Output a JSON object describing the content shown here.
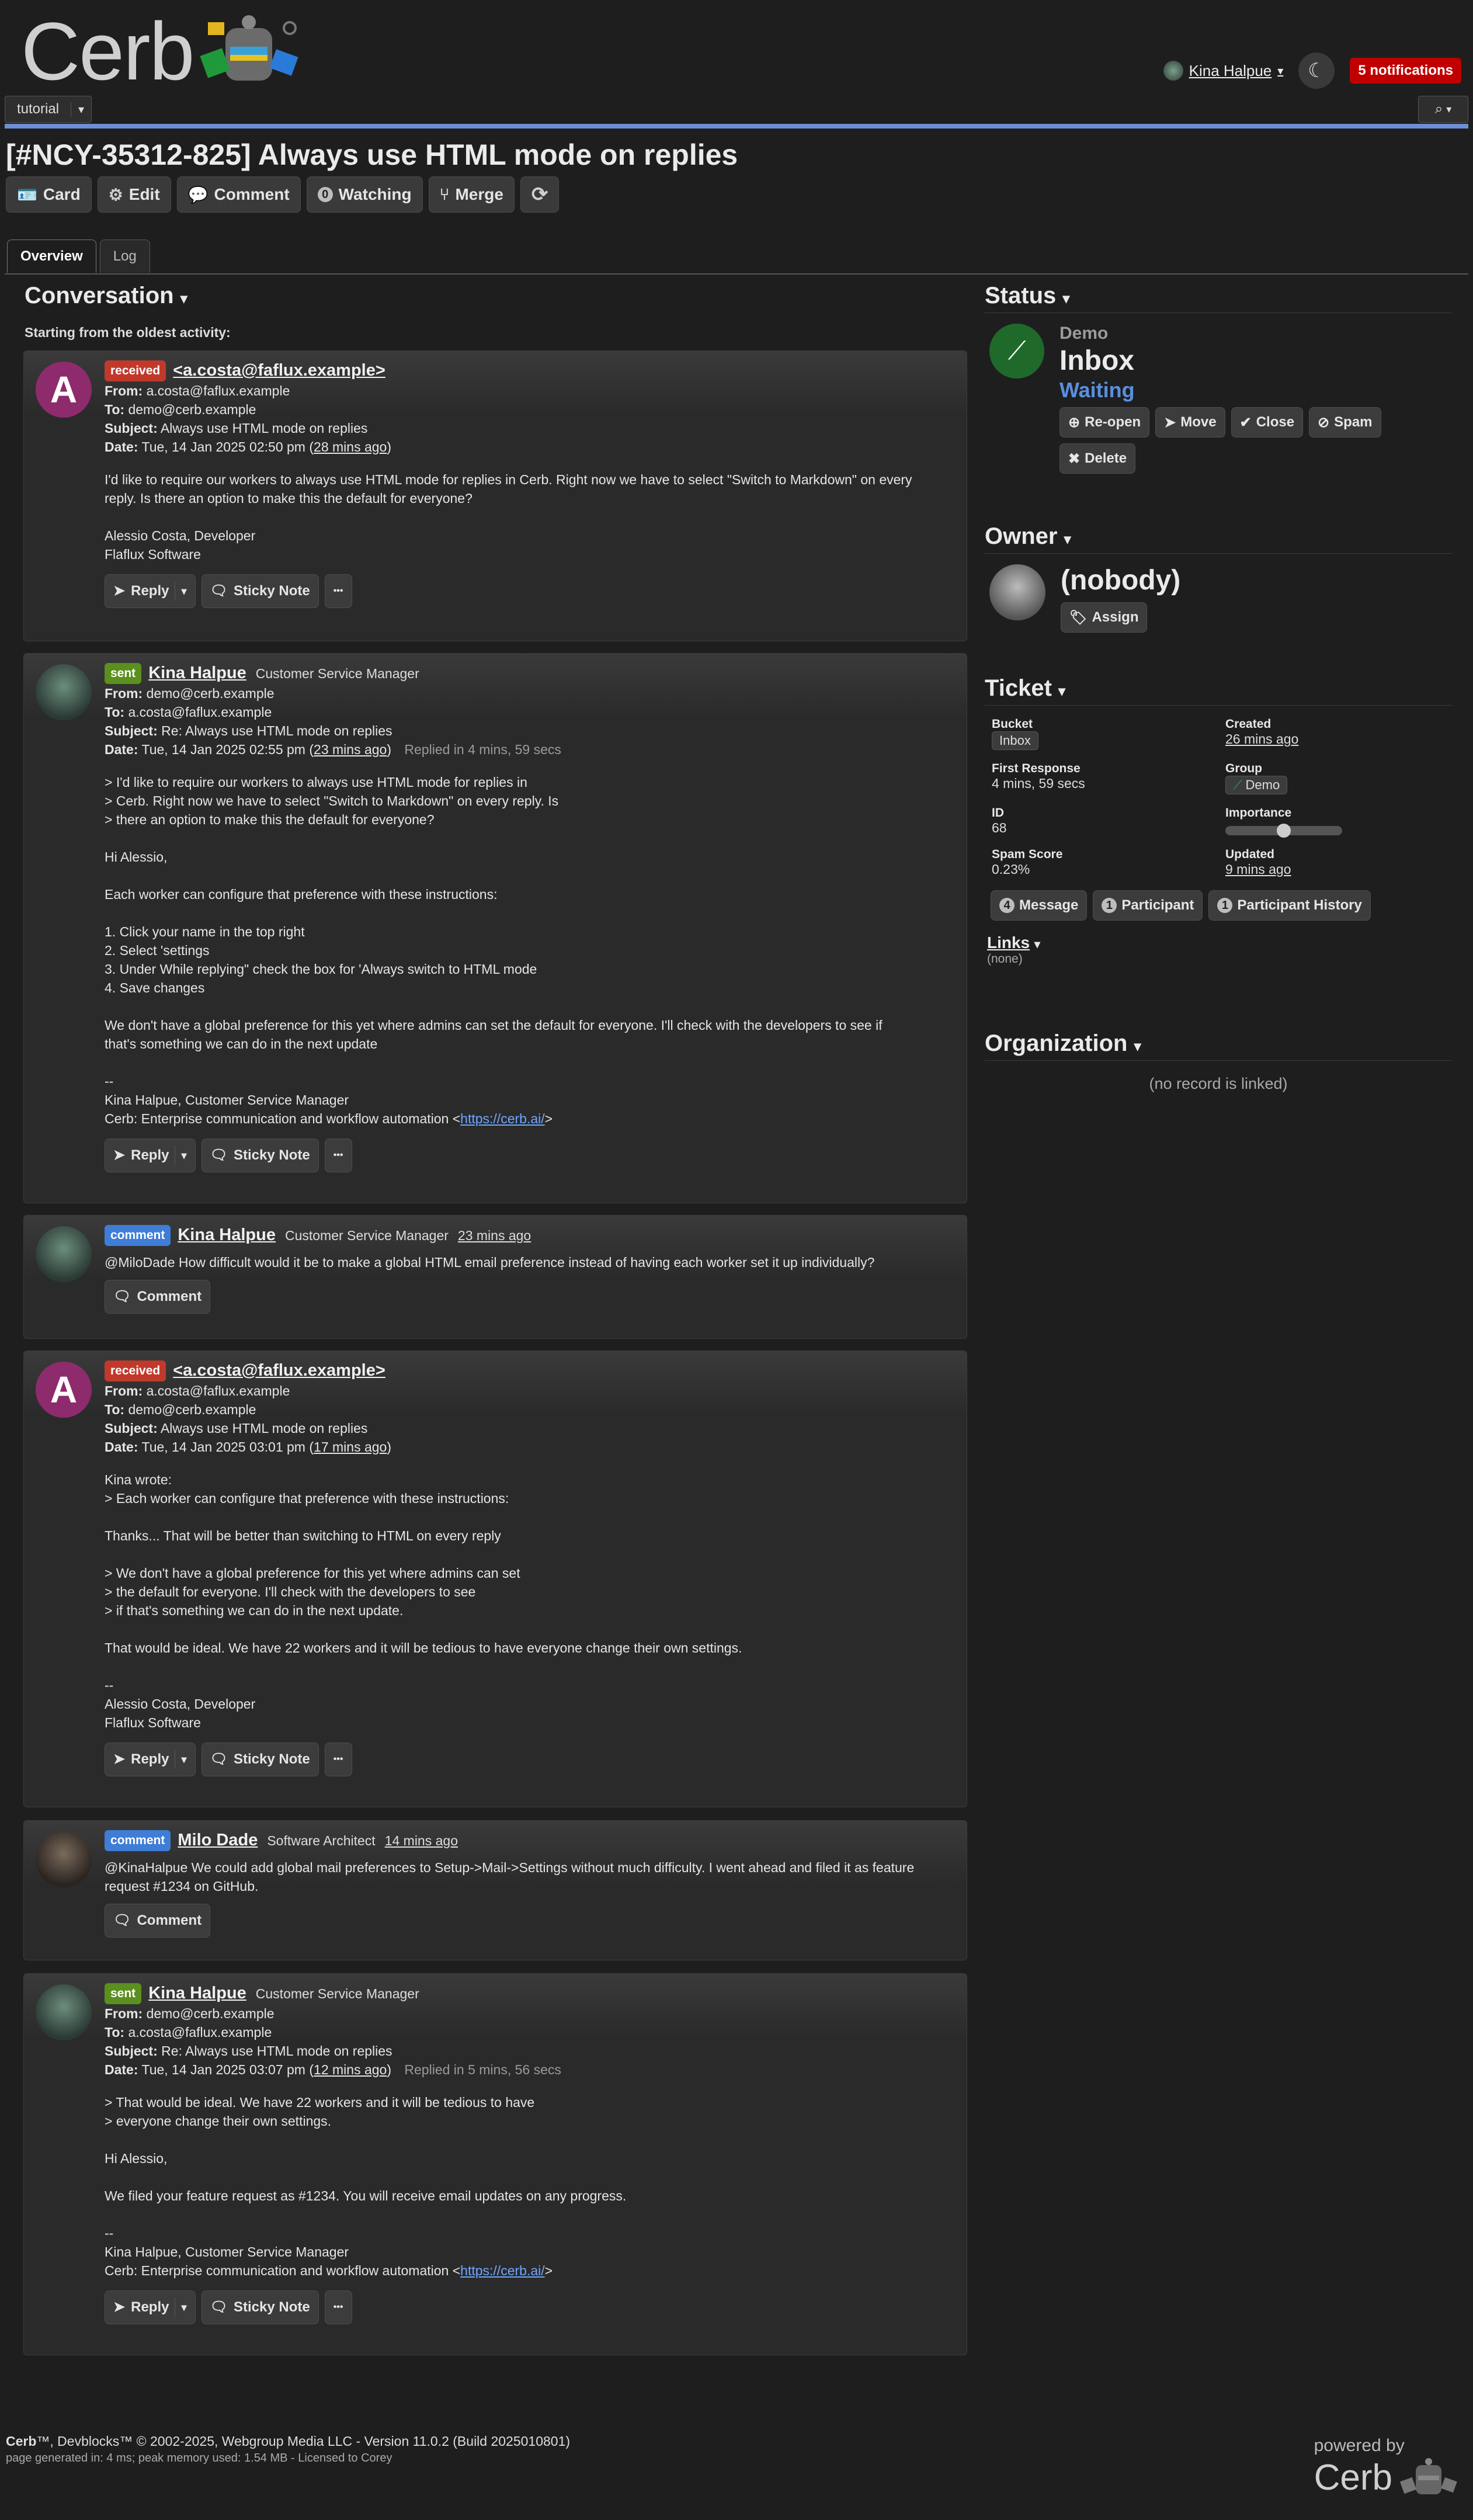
{
  "app": {
    "logo": "Cerb",
    "powered_by": "powered by",
    "powered_logo": "Cerb"
  },
  "header": {
    "user": "Kina Halpue",
    "notifications": "5 notifications"
  },
  "topbar": {
    "workspace": "tutorial"
  },
  "ticket": {
    "title": "[#NCY-35312-825] Always use HTML mode on replies",
    "toolbar": {
      "card": "Card",
      "edit": "Edit",
      "comment": "Comment",
      "watching_count": "0",
      "watching": "Watching",
      "merge": "Merge"
    },
    "tabs": [
      "Overview",
      "Log"
    ]
  },
  "conversation": {
    "heading": "Conversation",
    "sort_note": "Starting from the oldest activity:",
    "messages": [
      {
        "badge": "received",
        "sender": "<a.costa@faflux.example>",
        "avatar_letter": "A",
        "from": "a.costa@faflux.example",
        "to": "demo@cerb.example",
        "subject": "Always use HTML mode on replies",
        "date": "Tue, 14 Jan 2025 02:50 pm",
        "ago": "28 mins ago",
        "body": [
          "I'd like to require our workers to always use HTML mode for replies in Cerb. Right now we have to select \"Switch to Markdown\" on every",
          "reply. Is there an option to make this the default for everyone?",
          "",
          "Alessio Costa, Developer",
          "Flaflux Software"
        ]
      },
      {
        "badge": "sent",
        "sender": "Kina Halpue",
        "role": "Customer Service Manager",
        "from": "demo@cerb.example",
        "to": "a.costa@faflux.example",
        "subject": "Re: Always use HTML mode on replies",
        "date": "Tue, 14 Jan 2025 02:55 pm",
        "ago": "23 mins ago",
        "replied": "Replied in 4 mins, 59 secs",
        "body": [
          "> I'd like to require our workers to always use HTML mode for replies in",
          "> Cerb. Right now we have to select \"Switch to Markdown\" on every reply. Is",
          "> there an option to make this the default for everyone?",
          "",
          "Hi Alessio,",
          "",
          "Each worker can configure that preference with these instructions:",
          "",
          "1. Click your name in the top right",
          "2. Select 'settings",
          "3. Under While replying\" check the box for 'Always switch to HTML mode",
          "4. Save changes",
          "",
          "We don't have a global preference for this yet where admins can set the default for everyone. I'll check with the developers to see if",
          "that's something we can do in the next update",
          "",
          "--",
          "Kina Halpue, Customer Service Manager"
        ],
        "sig_prefix": "Cerb: Enterprise communication and workflow automation <",
        "sig_link": "https://cerb.ai/",
        "sig_suffix": ">"
      },
      {
        "badge": "comment",
        "sender": "Kina Halpue",
        "role": "Customer Service Manager",
        "ago": "23 mins ago",
        "body": "@MiloDade How difficult would it be to make a global HTML email preference instead of having each worker set it up individually?"
      },
      {
        "badge": "received",
        "sender": "<a.costa@faflux.example>",
        "avatar_letter": "A",
        "from": "a.costa@faflux.example",
        "to": "demo@cerb.example",
        "subject": "Always use HTML mode on replies",
        "date": "Tue, 14 Jan 2025 03:01 pm",
        "ago": "17 mins ago",
        "body": [
          "Kina wrote:",
          "> Each worker can configure that preference with these instructions:",
          "",
          "Thanks... That will be better than switching to HTML on every reply",
          "",
          "> We don't have a global preference for this yet where admins can set",
          "> the default for everyone. I'll check with the developers to see",
          "> if that's something we can do in the next update.",
          "",
          "That would be ideal. We have 22 workers and it will be tedious to have everyone change their own settings.",
          "",
          "--",
          "Alessio Costa, Developer",
          "Flaflux Software"
        ]
      },
      {
        "badge": "comment",
        "sender": "Milo Dade",
        "role": "Software Architect",
        "ago": "14 mins ago",
        "body": "@KinaHalpue We could add global mail preferences to Setup->Mail->Settings without much difficulty. I went ahead and filed it as feature",
        "body2": "request #1234 on GitHub."
      },
      {
        "badge": "sent",
        "sender": "Kina Halpue",
        "role": "Customer Service Manager",
        "from": "demo@cerb.example",
        "to": "a.costa@faflux.example",
        "subject": "Re: Always use HTML mode on replies",
        "date": "Tue, 14 Jan 2025 03:07 pm",
        "ago": "12 mins ago",
        "replied": "Replied in 5 mins, 56 secs",
        "body": [
          "> That would be ideal. We have 22 workers and it will be tedious to have",
          "> everyone change their own settings.",
          "",
          "Hi Alessio,",
          "",
          "We filed your feature request as #1234. You will receive email updates on any progress.",
          "",
          "--",
          "Kina Halpue, Customer Service Manager"
        ],
        "sig_prefix": "Cerb: Enterprise communication and workflow automation <",
        "sig_link": "https://cerb.ai/",
        "sig_suffix": ">"
      }
    ],
    "labels": {
      "from": "From:",
      "to": "To:",
      "subject": "Subject:",
      "date": "Date:",
      "reply": "Reply",
      "sticky": "Sticky Note",
      "comment": "Comment",
      "more": "•••"
    }
  },
  "status": {
    "heading": "Status",
    "group": "Demo",
    "bucket": "Inbox",
    "state": "Waiting",
    "buttons": [
      "Re-open",
      "Move",
      "Close",
      "Spam",
      "Delete"
    ]
  },
  "owner": {
    "heading": "Owner",
    "name": "(nobody)",
    "assign": "Assign"
  },
  "ticket_panel": {
    "heading": "Ticket",
    "bucket_label": "Bucket",
    "bucket": "Inbox",
    "created_label": "Created",
    "created": "26 mins ago",
    "first_response_label": "First Response",
    "first_response": "4 mins, 59 secs",
    "group_label": "Group",
    "group": "Demo",
    "id_label": "ID",
    "id": "68",
    "importance_label": "Importance",
    "importance": 0.5,
    "spam_label": "Spam Score",
    "spam": "0.23%",
    "updated_label": "Updated",
    "updated": "9 mins ago",
    "counters": [
      {
        "n": "4",
        "label": "Message"
      },
      {
        "n": "1",
        "label": "Participant"
      },
      {
        "n": "1",
        "label": "Participant History"
      }
    ],
    "links_label": "Links",
    "links_value": "(none)"
  },
  "organization": {
    "heading": "Organization",
    "empty": "(no record is linked)"
  },
  "footer": {
    "line1_bold": "Cerb",
    "line1": "™, Devblocks™ © 2002-2025, Webgroup Media LLC - Version 11.0.2 (Build 2025010801)",
    "line2": "page generated in: 4 ms; peak memory used: 1.54 MB - Licensed to Corey"
  }
}
